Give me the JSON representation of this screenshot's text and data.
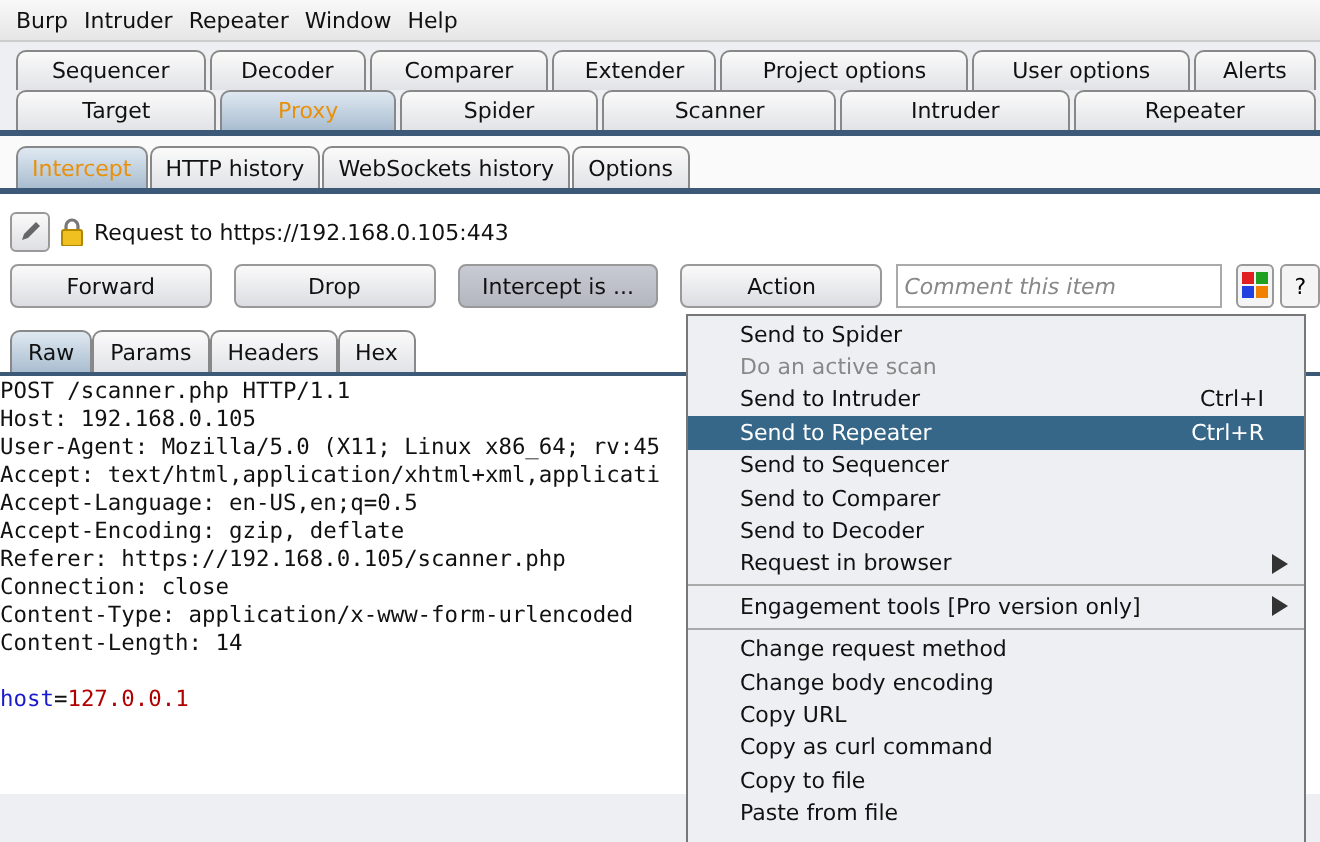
{
  "menu_bar": [
    "Burp",
    "Intruder",
    "Repeater",
    "Window",
    "Help"
  ],
  "tool_tabs_row_1": [
    {
      "label": "Sequencer",
      "selected": false
    },
    {
      "label": "Decoder",
      "selected": false
    },
    {
      "label": "Comparer",
      "selected": false
    },
    {
      "label": "Extender",
      "selected": false
    },
    {
      "label": "Project options",
      "selected": false
    },
    {
      "label": "User options",
      "selected": false
    },
    {
      "label": "Alerts",
      "selected": false
    }
  ],
  "tool_tabs_row_2": [
    {
      "label": "Target",
      "selected": false
    },
    {
      "label": "Proxy",
      "selected": true
    },
    {
      "label": "Spider",
      "selected": false
    },
    {
      "label": "Scanner",
      "selected": false
    },
    {
      "label": "Intruder",
      "selected": false
    },
    {
      "label": "Repeater",
      "selected": false
    }
  ],
  "proxy_tabs": [
    {
      "label": "Intercept",
      "selected": true
    },
    {
      "label": "HTTP history",
      "selected": false
    },
    {
      "label": "WebSockets history",
      "selected": false
    },
    {
      "label": "Options",
      "selected": false
    }
  ],
  "request_info": "Request to https://192.168.0.105:443",
  "toolbar": {
    "buttons": [
      {
        "label": "Forward",
        "selected": false
      },
      {
        "label": "Drop",
        "selected": false
      },
      {
        "label": "Intercept is ...",
        "selected": true
      },
      {
        "label": "Action",
        "selected": false
      }
    ],
    "comment": {
      "placeholder": "Comment this item"
    },
    "help": "?"
  },
  "message_tabs": [
    {
      "label": "Raw",
      "selected": true
    },
    {
      "label": "Params",
      "selected": false
    },
    {
      "label": "Headers",
      "selected": false
    },
    {
      "label": "Hex",
      "selected": false
    }
  ],
  "request_lines": [
    {
      "kind": "text",
      "text": "POST /scanner.php HTTP/1.1"
    },
    {
      "kind": "text",
      "text": "Host: 192.168.0.105"
    },
    {
      "kind": "text",
      "text": "User-Agent: Mozilla/5.0 (X11; Linux x86_64; rv:45"
    },
    {
      "kind": "text",
      "text": "Accept: text/html,application/xhtml+xml,applicati"
    },
    {
      "kind": "text",
      "text": "Accept-Language: en-US,en;q=0.5"
    },
    {
      "kind": "text",
      "text": "Accept-Encoding: gzip, deflate"
    },
    {
      "kind": "text",
      "text": "Referer: https://192.168.0.105/scanner.php"
    },
    {
      "kind": "text",
      "text": "Connection: close"
    },
    {
      "kind": "text",
      "text": "Content-Type: application/x-www-form-urlencoded"
    },
    {
      "kind": "text",
      "text": "Content-Length: 14"
    },
    {
      "kind": "blank"
    },
    {
      "kind": "param",
      "name": "host",
      "separator": "=",
      "value": "127.0.0.1"
    }
  ],
  "context_menu": [
    {
      "kind": "item",
      "label": "Send to Spider",
      "disabled": false,
      "selected": false
    },
    {
      "kind": "item",
      "label": "Do an active scan",
      "disabled": true,
      "selected": false
    },
    {
      "kind": "item",
      "label": "Send to Intruder",
      "shortcut": "Ctrl+I",
      "disabled": false,
      "selected": false
    },
    {
      "kind": "item",
      "label": "Send to Repeater",
      "shortcut": "Ctrl+R",
      "disabled": false,
      "selected": true
    },
    {
      "kind": "item",
      "label": "Send to Sequencer",
      "disabled": false,
      "selected": false
    },
    {
      "kind": "item",
      "label": "Send to Comparer",
      "disabled": false,
      "selected": false
    },
    {
      "kind": "item",
      "label": "Send to Decoder",
      "disabled": false,
      "selected": false
    },
    {
      "kind": "submenu",
      "label": "Request in browser",
      "disabled": false,
      "selected": false
    },
    {
      "kind": "separator"
    },
    {
      "kind": "submenu",
      "label": "Engagement tools [Pro version only]",
      "disabled": false,
      "selected": false
    },
    {
      "kind": "separator"
    },
    {
      "kind": "item",
      "label": "Change request method",
      "disabled": false,
      "selected": false
    },
    {
      "kind": "item",
      "label": "Change body encoding",
      "disabled": false,
      "selected": false
    },
    {
      "kind": "item",
      "label": "Copy URL",
      "disabled": false,
      "selected": false
    },
    {
      "kind": "item",
      "label": "Copy as curl command",
      "disabled": false,
      "selected": false
    },
    {
      "kind": "item",
      "label": "Copy to file",
      "disabled": false,
      "selected": false
    },
    {
      "kind": "item",
      "label": "Paste from file",
      "disabled": false,
      "selected": false
    }
  ]
}
